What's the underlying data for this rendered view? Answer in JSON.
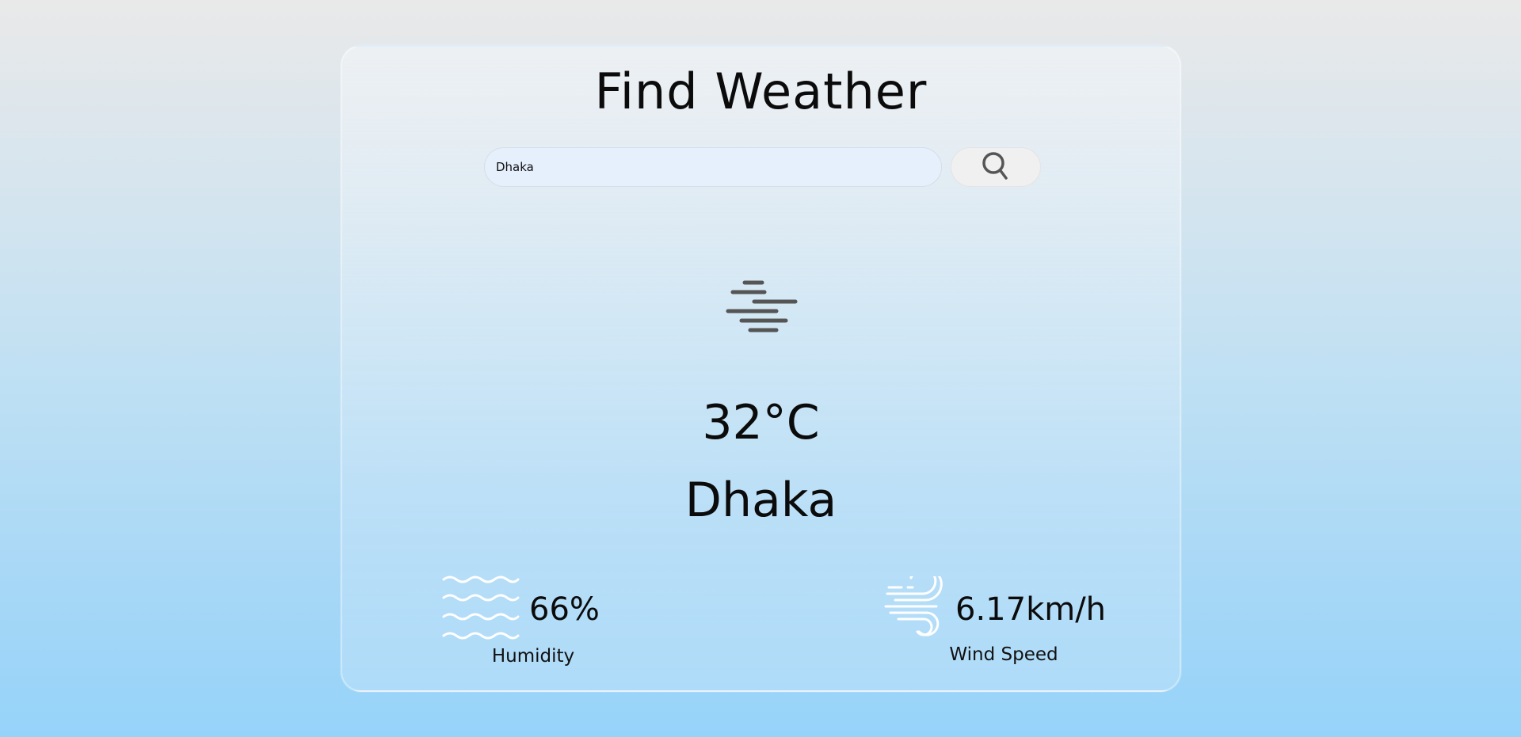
{
  "app": {
    "title": "Find Weather"
  },
  "search": {
    "value": "Dhaka",
    "button_icon": "search-icon"
  },
  "weather": {
    "icon": "mist-icon",
    "temperature": "32°C",
    "city": "Dhaka"
  },
  "details": {
    "humidity": {
      "icon": "humidity-waves-icon",
      "value": "66%",
      "label": "Humidity"
    },
    "wind": {
      "icon": "wind-icon",
      "value": "6.17km/h",
      "label": "Wind Speed"
    }
  },
  "colors": {
    "text": "#0b0b0b",
    "icon_dark": "#555555",
    "icon_light": "#ffffff",
    "input_bg": "#e6effc",
    "button_bg": "#f0f0f0"
  }
}
